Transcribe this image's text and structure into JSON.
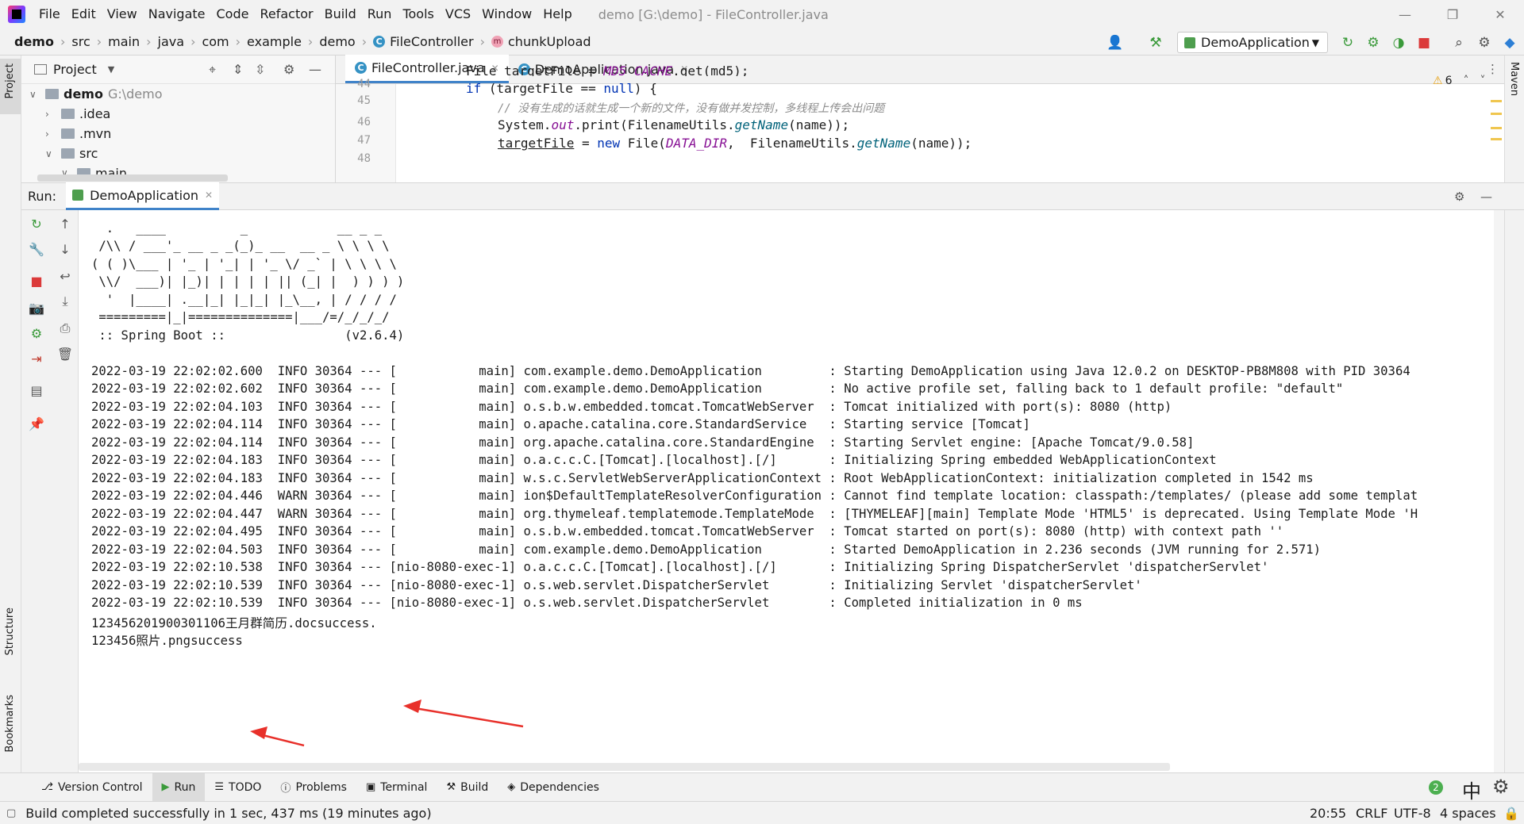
{
  "menubar": {
    "items": [
      "File",
      "Edit",
      "View",
      "Navigate",
      "Code",
      "Refactor",
      "Build",
      "Run",
      "Tools",
      "VCS",
      "Window",
      "Help"
    ],
    "window_title": "demo [G:\\demo] - FileController.java"
  },
  "navbar": {
    "breadcrumbs": [
      "demo",
      "src",
      "main",
      "java",
      "com",
      "example",
      "demo",
      "FileController",
      "chunkUpload"
    ],
    "run_config": "DemoApplication"
  },
  "project_panel": {
    "title": "Project",
    "tree": [
      {
        "label": "demo",
        "path": "G:\\demo"
      },
      {
        "label": ".idea"
      },
      {
        "label": ".mvn"
      },
      {
        "label": "src"
      },
      {
        "label": "main"
      }
    ]
  },
  "editor": {
    "tabs": [
      "FileController.java",
      "DemoApplication.java"
    ],
    "warning_count": "6",
    "line_numbers": [
      "44",
      "45",
      "46",
      "47",
      "48"
    ],
    "code": {
      "l44_a": "File targetFile = ",
      "l44_b": "MD5_CACHE",
      "l44_c": ".get(md5);",
      "l45_a": "if",
      "l45_b": " (targetFile == ",
      "l45_c": "null",
      "l45_d": ") {",
      "l46": "// 没有生成的话就生成一个新的文件，没有做并发控制，多线程上传会出问题",
      "l47_a": "System.",
      "l47_b": "out",
      "l47_c": ".print(FilenameUtils.",
      "l47_d": "getName",
      "l47_e": "(name));",
      "l48_a": "targetFile",
      "l48_b": " = ",
      "l48_c": "new",
      "l48_d": " File(",
      "l48_e": "DATA_DIR",
      "l48_f": ",  FilenameUtils.",
      "l48_g": "getName",
      "l48_h": "(name));"
    }
  },
  "run_window": {
    "label": "Run:",
    "tab": "DemoApplication",
    "console": [
      "  .   ____          _            __ _ _",
      " /\\\\ / ___'_ __ _ _(_)_ __  __ _ \\ \\ \\ \\",
      "( ( )\\___ | '_ | '_| | '_ \\/ _` | \\ \\ \\ \\",
      " \\\\/  ___)| |_)| | | | | || (_| |  ) ) ) )",
      "  '  |____| .__|_| |_|_| |_\\__, | / / / /",
      " =========|_|==============|___/=/_/_/_/",
      " :: Spring Boot ::                (v2.6.4)",
      "",
      "2022-03-19 22:02:02.600  INFO 30364 --- [           main] com.example.demo.DemoApplication         : Starting DemoApplication using Java 12.0.2 on DESKTOP-PB8M808 with PID 30364",
      "2022-03-19 22:02:02.602  INFO 30364 --- [           main] com.example.demo.DemoApplication         : No active profile set, falling back to 1 default profile: \"default\"",
      "2022-03-19 22:02:04.103  INFO 30364 --- [           main] o.s.b.w.embedded.tomcat.TomcatWebServer  : Tomcat initialized with port(s): 8080 (http)",
      "2022-03-19 22:02:04.114  INFO 30364 --- [           main] o.apache.catalina.core.StandardService   : Starting service [Tomcat]",
      "2022-03-19 22:02:04.114  INFO 30364 --- [           main] org.apache.catalina.core.StandardEngine  : Starting Servlet engine: [Apache Tomcat/9.0.58]",
      "2022-03-19 22:02:04.183  INFO 30364 --- [           main] o.a.c.c.C.[Tomcat].[localhost].[/]       : Initializing Spring embedded WebApplicationContext",
      "2022-03-19 22:02:04.183  INFO 30364 --- [           main] w.s.c.ServletWebServerApplicationContext : Root WebApplicationContext: initialization completed in 1542 ms",
      "2022-03-19 22:02:04.446  WARN 30364 --- [           main] ion$DefaultTemplateResolverConfiguration : Cannot find template location: classpath:/templates/ (please add some templat",
      "2022-03-19 22:02:04.447  WARN 30364 --- [           main] org.thymeleaf.templatemode.TemplateMode  : [THYMELEAF][main] Template Mode 'HTML5' is deprecated. Using Template Mode 'H",
      "2022-03-19 22:02:04.495  INFO 30364 --- [           main] o.s.b.w.embedded.tomcat.TomcatWebServer  : Tomcat started on port(s): 8080 (http) with context path ''",
      "2022-03-19 22:02:04.503  INFO 30364 --- [           main] com.example.demo.DemoApplication         : Started DemoApplication in 2.236 seconds (JVM running for 2.571)",
      "2022-03-19 22:02:10.538  INFO 30364 --- [nio-8080-exec-1] o.a.c.c.C.[Tomcat].[localhost].[/]       : Initializing Spring DispatcherServlet 'dispatcherServlet'",
      "2022-03-19 22:02:10.539  INFO 30364 --- [nio-8080-exec-1] o.s.web.servlet.DispatcherServlet        : Initializing Servlet 'dispatcherServlet'",
      "2022-03-19 22:02:10.539  INFO 30364 --- [nio-8080-exec-1] o.s.web.servlet.DispatcherServlet        : Completed initialization in 0 ms",
      "123456201900301106王月群简历.docsuccess.",
      "123456照片.pngsuccess"
    ]
  },
  "side_labels": {
    "project": "Project",
    "structure": "Structure",
    "bookmarks": "Bookmarks",
    "maven": "Maven"
  },
  "bottom_tabs": [
    "Version Control",
    "Run",
    "TODO",
    "Problems",
    "Terminal",
    "Build",
    "Dependencies"
  ],
  "statusbar": {
    "message": "Build completed successfully in 1 sec, 437 ms (19 minutes ago)",
    "position": "20:55",
    "line_sep": "CRLF",
    "encoding": "UTF-8",
    "indent": "4 spaces",
    "notifications": "2",
    "ime": "中"
  },
  "colors": {
    "accent": "#4083c9",
    "keyword": "#0033b3",
    "arrow": "#e8302a",
    "run_green": "#3a9a3a",
    "stop_red": "#db3a3a"
  }
}
